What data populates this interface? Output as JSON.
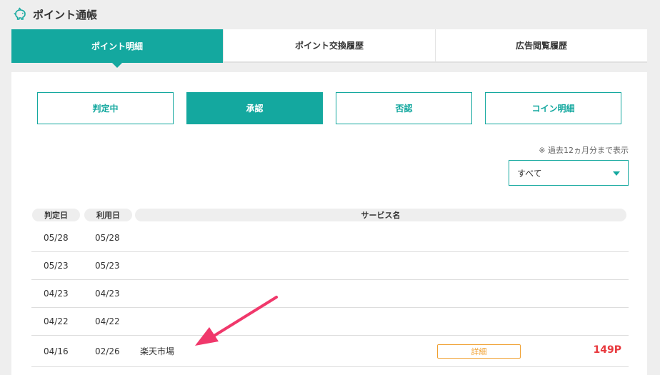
{
  "header": {
    "title": "ポイント通帳",
    "icon": "piggy-bank-icon"
  },
  "tabs": [
    {
      "label": "ポイント明細",
      "active": true
    },
    {
      "label": "ポイント交換履歴",
      "active": false
    },
    {
      "label": "広告閲覧履歴",
      "active": false
    }
  ],
  "filters": [
    {
      "label": "判定中",
      "active": false
    },
    {
      "label": "承認",
      "active": true
    },
    {
      "label": "否認",
      "active": false
    },
    {
      "label": "コイン明細",
      "active": false
    }
  ],
  "note": "※ 過去12ヵ月分まで表示",
  "select": {
    "value": "すべて"
  },
  "table": {
    "headers": [
      "判定日",
      "利用日",
      "サービス名"
    ],
    "rows": [
      {
        "judged": "05/28",
        "used": "05/28",
        "service": "",
        "detail": "",
        "points": ""
      },
      {
        "judged": "05/23",
        "used": "05/23",
        "service": "",
        "detail": "",
        "points": ""
      },
      {
        "judged": "04/23",
        "used": "04/23",
        "service": "",
        "detail": "",
        "points": ""
      },
      {
        "judged": "04/22",
        "used": "04/22",
        "service": "",
        "detail": "",
        "points": ""
      },
      {
        "judged": "04/16",
        "used": "02/26",
        "service": "楽天市場",
        "detail": "詳細",
        "points": "149P"
      }
    ]
  },
  "colors": {
    "accent": "#14a89f",
    "points": "#e8383d",
    "detail": "#f0a030",
    "arrow": "#f0386b"
  }
}
